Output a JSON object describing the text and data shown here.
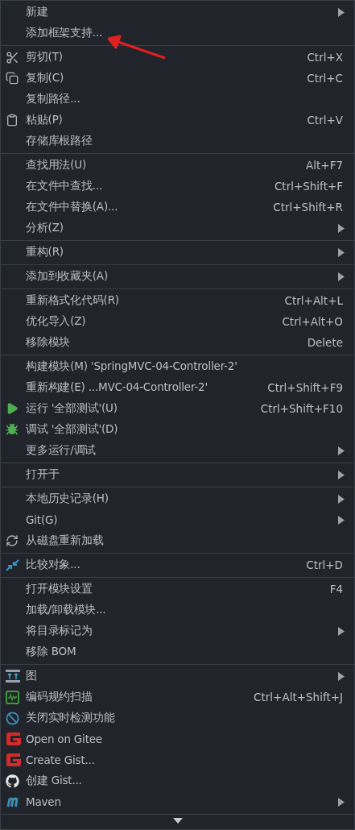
{
  "menu": {
    "groups": [
      {
        "items": [
          {
            "label": "新建",
            "submenu": true
          },
          {
            "label": "添加框架支持...",
            "submenu": false,
            "annotated": true
          }
        ]
      },
      {
        "items": [
          {
            "label": "剪切(T)",
            "shortcut": "Ctrl+X",
            "submenu": false,
            "kind": "scissors"
          },
          {
            "label": "复制(C)",
            "shortcut": "Ctrl+C",
            "submenu": false,
            "kind": "copy"
          },
          {
            "label": "复制路径...",
            "submenu": false
          },
          {
            "label": "粘贴(P)",
            "shortcut": "Ctrl+V",
            "submenu": false,
            "kind": "paste"
          },
          {
            "label": "存储库根路径",
            "submenu": false
          }
        ]
      },
      {
        "items": [
          {
            "label": "查找用法(U)",
            "shortcut": "Alt+F7",
            "submenu": false
          },
          {
            "label": "在文件中查找...",
            "shortcut": "Ctrl+Shift+F",
            "submenu": false
          },
          {
            "label": "在文件中替换(A)...",
            "shortcut": "Ctrl+Shift+R",
            "submenu": false
          },
          {
            "label": "分析(Z)",
            "submenu": true
          }
        ]
      },
      {
        "items": [
          {
            "label": "重构(R)",
            "submenu": true
          }
        ]
      },
      {
        "items": [
          {
            "label": "添加到收藏夹(A)",
            "submenu": true
          }
        ]
      },
      {
        "items": [
          {
            "label": "重新格式化代码(R)",
            "shortcut": "Ctrl+Alt+L",
            "submenu": false
          },
          {
            "label": "优化导入(Z)",
            "shortcut": "Ctrl+Alt+O",
            "submenu": false
          },
          {
            "label": "移除模块",
            "shortcut": "Delete",
            "submenu": false
          }
        ]
      },
      {
        "items": [
          {
            "label": "构建模块(M) 'SpringMVC-04-Controller-2'",
            "submenu": false
          },
          {
            "label": "重新构建(E) ...MVC-04-Controller-2'",
            "shortcut": "Ctrl+Shift+F9",
            "submenu": false
          },
          {
            "label": "运行 '全部测试'(U)",
            "shortcut": "Ctrl+Shift+F10",
            "submenu": false,
            "kind": "play"
          },
          {
            "label": "调试 '全部测试'(D)",
            "submenu": false,
            "kind": "bug"
          },
          {
            "label": "更多运行/调试",
            "submenu": true
          }
        ]
      },
      {
        "items": [
          {
            "label": "打开于",
            "submenu": true
          }
        ]
      },
      {
        "items": [
          {
            "label": "本地历史记录(H)",
            "submenu": true
          },
          {
            "label": "Git(G)",
            "submenu": true
          },
          {
            "label": "从磁盘重新加载",
            "submenu": false,
            "kind": "reload"
          }
        ]
      },
      {
        "items": [
          {
            "label": "比较对象...",
            "shortcut": "Ctrl+D",
            "submenu": false,
            "kind": "compare"
          }
        ]
      },
      {
        "items": [
          {
            "label": "打开模块设置",
            "shortcut": "F4",
            "submenu": false
          },
          {
            "label": "加载/卸载模块...",
            "submenu": false
          },
          {
            "label": "将目录标记为",
            "submenu": true
          },
          {
            "label": "移除 BOM",
            "submenu": false
          }
        ]
      },
      {
        "items": [
          {
            "label": "图",
            "submenu": true,
            "kind": "diagram"
          },
          {
            "label": "编码规约扫描",
            "shortcut": "Ctrl+Alt+Shift+J",
            "submenu": false,
            "kind": "scan"
          },
          {
            "label": "关闭实时检测功能",
            "submenu": false,
            "kind": "block"
          },
          {
            "label": "Open on Gitee",
            "submenu": false,
            "kind": "gitee"
          },
          {
            "label": "Create Gist...",
            "submenu": false,
            "kind": "gitee"
          },
          {
            "label": "创建 Gist...",
            "submenu": false,
            "kind": "github"
          },
          {
            "label": "Maven",
            "submenu": true,
            "kind": "maven"
          }
        ]
      }
    ],
    "scroll_down": true
  }
}
